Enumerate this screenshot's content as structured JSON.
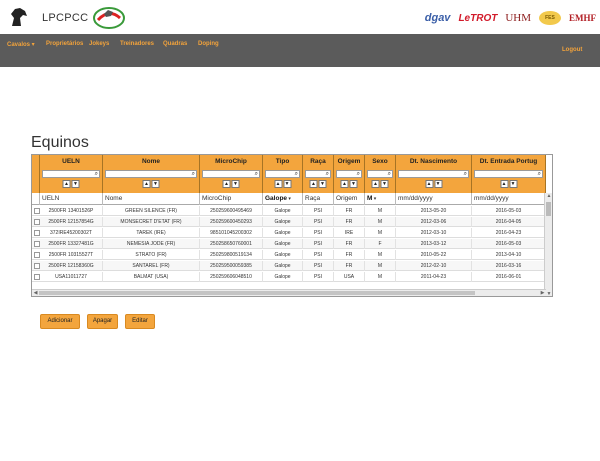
{
  "brand": {
    "name": "LPCPCC",
    "horse_icon": "horse-head-icon",
    "logo_icon": "lpcpcc-crest-icon"
  },
  "sponsors": [
    "dgav",
    "LeTROT",
    "UHM",
    "FES",
    "EMHF"
  ],
  "nav": {
    "items": [
      "Cavalos ▾",
      "Proprietários",
      "Jokeys",
      "Treinadores",
      "Quadras",
      "Doping"
    ],
    "logout": "Logout"
  },
  "page_title": "Equinos",
  "table": {
    "columns": [
      "UELN",
      "Nome",
      "MicroChip",
      "Tipo",
      "Raça",
      "Origem",
      "Sexo",
      "Dt. Nascimento",
      "Dt. Entrada Portug"
    ],
    "filters": {
      "ueln_placeholder": "UELN",
      "nome_placeholder": "Nome",
      "microchip_placeholder": "MicroChip",
      "tipo_value": "Galope",
      "raca_placeholder": "Raça",
      "origem_placeholder": "Origem",
      "sexo_value": "M",
      "nascimento_placeholder": "mm/dd/yyyy",
      "entrada_placeholder": "mm/dd/yyyy"
    },
    "rows": [
      [
        "2500FR 13401526P",
        "GREEN SILENCE (FR)",
        "250259600495469",
        "Galope",
        "PSI",
        "FR",
        "M",
        "2013-05-20",
        "2016-05-03"
      ],
      [
        "2500FR 12157854G",
        "MONSECRET D'ETAT (FR)",
        "250259600450293",
        "Galope",
        "PSI",
        "FR",
        "M",
        "2012-03-06",
        "2016-04-05"
      ],
      [
        "372IRE45200302T",
        "TAREK (IRE)",
        "985101045200302",
        "Galope",
        "PSI",
        "IRE",
        "M",
        "2012-03-10",
        "2016-04-23"
      ],
      [
        "2500FR 13327481G",
        "NEMESIA JODE (FR)",
        "250258650760001",
        "Galope",
        "PSI",
        "FR",
        "F",
        "2013-03-12",
        "2016-05-03"
      ],
      [
        "2500FR 10315527T",
        "STRATO (FR)",
        "250259800519134",
        "Galope",
        "PSI",
        "FR",
        "M",
        "2010-05-22",
        "2013-04-10"
      ],
      [
        "2500FR 12158360G",
        "SANTAREL (FR)",
        "250259500059385",
        "Galope",
        "PSI",
        "FR",
        "M",
        "2012-02-10",
        "2016-03-16"
      ],
      [
        "USA11011727",
        "BALMAT (USA)",
        "250259606048510",
        "Galope",
        "PSI",
        "USA",
        "M",
        "2011-04-23",
        "2016-06-01"
      ]
    ]
  },
  "buttons": {
    "add": "Adicionar",
    "delete": "Apagar",
    "edit": "Editar"
  },
  "colors": {
    "accent": "#f3a53d",
    "navbar": "#5b5b5b",
    "nav_text": "#f3a33b"
  }
}
